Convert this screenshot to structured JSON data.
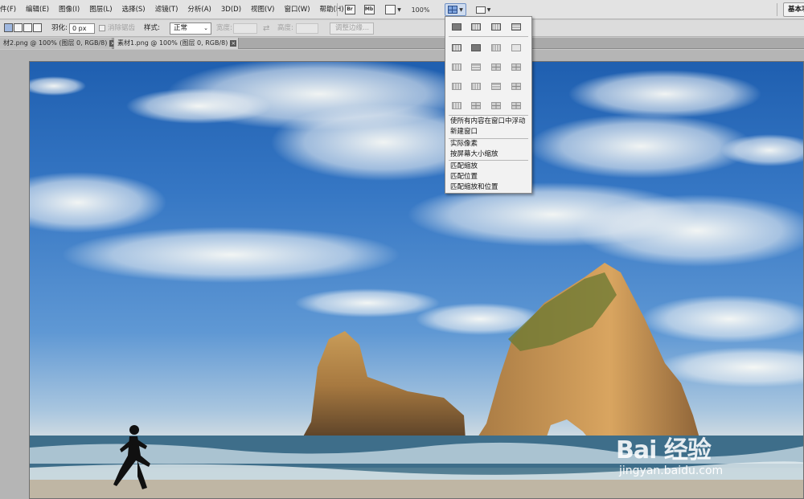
{
  "menubar": {
    "items": [
      "件(F)",
      "编辑(E)",
      "图像(I)",
      "图层(L)",
      "选择(S)",
      "滤镜(T)",
      "分析(A)",
      "3D(D)",
      "视图(V)",
      "窗口(W)",
      "帮助(H)"
    ],
    "bridge_icon": "Br",
    "minibridge_icon": "Mb",
    "zoom_level": "100%",
    "workspace_label": "基本功能"
  },
  "optionsbar": {
    "feather_label": "羽化:",
    "feather_value": "0 px",
    "antialias_label": "消除锯齿",
    "style_label": "样式:",
    "style_value": "正常",
    "width_label": "宽度:",
    "height_label": "高度:",
    "refine_edge_label": "调整边缘..."
  },
  "tabs": [
    {
      "label": "材2.png @ 100% (图层 0, RGB/8)"
    },
    {
      "label": "素材1.png @ 100% (图层 0, RGB/8)"
    }
  ],
  "arrange_menu": {
    "items": [
      {
        "label": "使所有内容在窗口中浮动"
      },
      {
        "label": "新建窗口"
      },
      {
        "label": "实际像素"
      },
      {
        "label": "按屏幕大小缩放"
      },
      {
        "label": "匹配缩放"
      },
      {
        "label": "匹配位置"
      },
      {
        "label": "匹配缩放和位置"
      }
    ]
  },
  "watermark": {
    "logo": "Bai 经验",
    "url": "jingyan.baidu.com"
  },
  "colors": {
    "menubar_bg": "#e3e3e3",
    "workspace_bg": "#b5b5b5",
    "sky": "#3677c4",
    "active_button": "#cfdcef"
  }
}
